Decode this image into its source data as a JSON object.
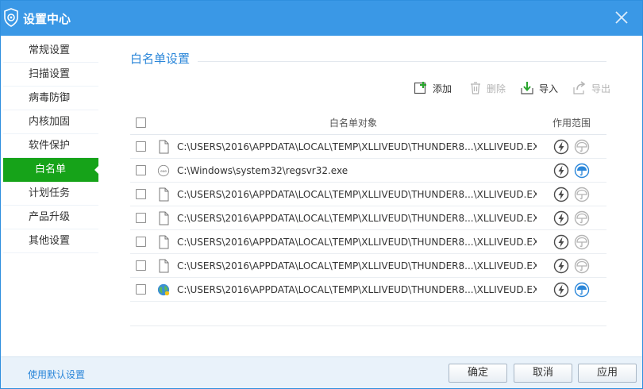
{
  "window": {
    "title": "设置中心"
  },
  "sidebar": {
    "items": [
      {
        "label": "常规设置"
      },
      {
        "label": "扫描设置"
      },
      {
        "label": "病毒防御"
      },
      {
        "label": "内核加固"
      },
      {
        "label": "软件保护"
      },
      {
        "label": "白名单",
        "active": true
      },
      {
        "label": "计划任务"
      },
      {
        "label": "产品升级"
      },
      {
        "label": "其他设置"
      }
    ]
  },
  "section": {
    "title": "白名单设置"
  },
  "toolbar": {
    "add_label": "添加",
    "delete_label": "删除",
    "import_label": "导入",
    "export_label": "导出"
  },
  "table": {
    "col_object": "白名单对象",
    "col_scope": "作用范围",
    "rows": [
      {
        "path": "C:\\USERS\\2016\\APPDATA\\LOCAL\\TEMP\\XLLIVEUD\\THUNDER8...\\XLLIVEUD.EXE",
        "icon": "file-icon",
        "scope_lightning": true,
        "scope_umbrella": false
      },
      {
        "path": "C:\\Windows\\system32\\regsvr32.exe",
        "icon": "exe-icon",
        "scope_lightning": true,
        "scope_umbrella": true
      },
      {
        "path": "C:\\USERS\\2016\\APPDATA\\LOCAL\\TEMP\\XLLIVEUD\\THUNDER8...\\XLLIVEUD.EXE",
        "icon": "file-icon",
        "scope_lightning": true,
        "scope_umbrella": false
      },
      {
        "path": "C:\\USERS\\2016\\APPDATA\\LOCAL\\TEMP\\XLLIVEUD\\THUNDER8...\\XLLIVEUD.EXE",
        "icon": "file-icon",
        "scope_lightning": true,
        "scope_umbrella": false
      },
      {
        "path": "C:\\USERS\\2016\\APPDATA\\LOCAL\\TEMP\\XLLIVEUD\\THUNDER8...\\XLLIVEUD.EXE",
        "icon": "file-icon",
        "scope_lightning": true,
        "scope_umbrella": false
      },
      {
        "path": "C:\\USERS\\2016\\APPDATA\\LOCAL\\TEMP\\XLLIVEUD\\THUNDER8...\\XLLIVEUD.EXE",
        "icon": "file-icon",
        "scope_lightning": true,
        "scope_umbrella": false
      },
      {
        "path": "C:\\USERS\\2016\\APPDATA\\LOCAL\\TEMP\\XLLIVEUD\\THUNDER8...\\XLLIVEUD.EXE",
        "icon": "globe-icon",
        "scope_lightning": true,
        "scope_umbrella": true
      }
    ]
  },
  "footer": {
    "default_link": "使用默认设置",
    "ok_label": "确定",
    "cancel_label": "取消",
    "apply_label": "应用"
  },
  "colors": {
    "titlebar": "#3a98e6",
    "active_item": "#16a319",
    "link": "#2a86d9",
    "umbrella_active": "#2a86d9",
    "icon_dark": "#4a4a4a",
    "icon_disabled": "#b4b4b4"
  }
}
